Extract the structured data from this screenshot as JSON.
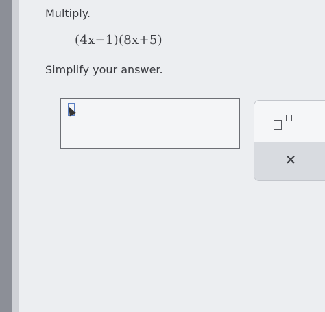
{
  "question": {
    "instruction": "Multiply.",
    "expression": "(4x−1)(8x+5)",
    "prompt": "Simplify your answer."
  },
  "answer": {
    "value": ""
  },
  "toolbar": {
    "exponent_icon": "exponent-template-icon",
    "clear_symbol": "✕"
  }
}
